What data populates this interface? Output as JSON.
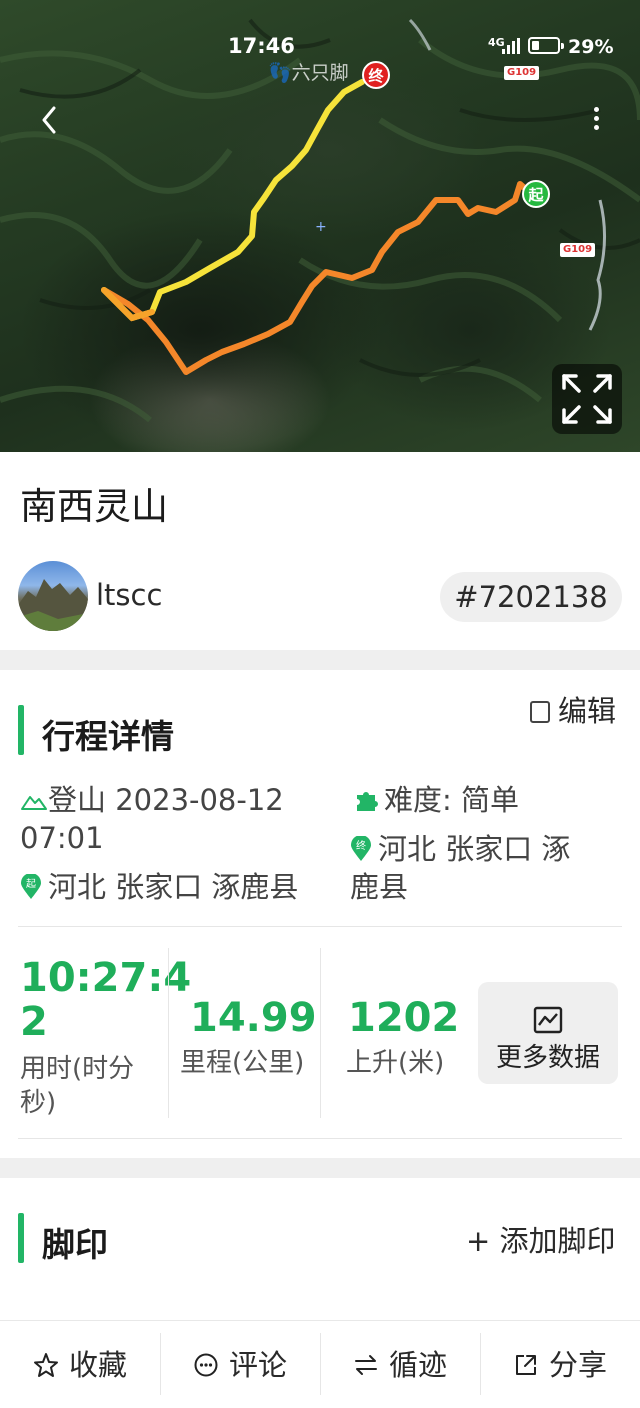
{
  "status_bar": {
    "time": "17:46",
    "signal": "4G",
    "battery_percent": "29%",
    "battery_level": 0.29
  },
  "map": {
    "watermark": "六只脚",
    "end_marker": "终",
    "start_marker": "起",
    "road_labels": [
      "G109",
      "G109"
    ]
  },
  "trail": {
    "title": "南西灵山"
  },
  "user": {
    "name": "ltscc",
    "trip_id": "#7202138"
  },
  "trip_details": {
    "section_title": "行程详情",
    "edit_label": "编辑",
    "activity_line1": "登山 2023-08-12",
    "activity_line2": "07:01",
    "start_location": "河北 张家口 涿鹿县",
    "difficulty": "难度:  简单",
    "end_location_line1": "河北 张家口 涿",
    "end_location_line2": "鹿县",
    "end_pin": "终",
    "start_pin": "起"
  },
  "stats": {
    "duration_value_line1": "10:27:4",
    "duration_value_line2": "2",
    "duration_label_line1": "用时(时分",
    "duration_label_line2": "秒)",
    "distance_value": "14.99",
    "distance_label": "里程(公里)",
    "ascent_value": "1202",
    "ascent_label": "上升(米)",
    "more_data_label": "更多数据"
  },
  "footprints": {
    "section_title": "脚印",
    "add_label": "+ 添加脚印"
  },
  "bottom_bar": {
    "favorite": "收藏",
    "comment": "评论",
    "follow_track": "循迹",
    "share": "分享"
  },
  "colors": {
    "accent": "#22b566",
    "stat_value": "#1fae5a",
    "end_marker": "#e02020",
    "start_marker": "#25b83f"
  },
  "icons": [
    "back-icon",
    "more-icon",
    "expand-icon",
    "mountain-icon",
    "puzzle-icon",
    "pin-icon",
    "chart-icon",
    "star-icon",
    "comment-icon",
    "swap-icon",
    "share-icon",
    "edit-icon"
  ]
}
